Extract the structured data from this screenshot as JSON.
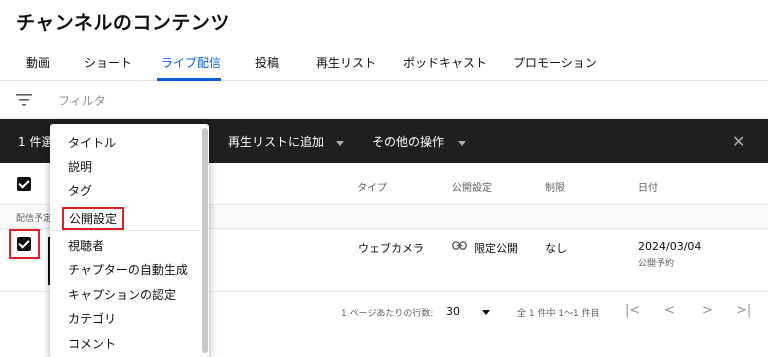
{
  "page": {
    "title": "チャンネルのコンテンツ"
  },
  "tabs": [
    {
      "label": "動画"
    },
    {
      "label": "ショート"
    },
    {
      "label": "ライブ配信"
    },
    {
      "label": "投稿"
    },
    {
      "label": "再生リスト"
    },
    {
      "label": "ポッドキャスト"
    },
    {
      "label": "プロモーション"
    }
  ],
  "active_tab": "ライブ配信",
  "filter": {
    "placeholder": "フィルタ",
    "icon": "filter-icon"
  },
  "actionbar": {
    "selected_count": "1 件選",
    "add_to_playlist": "再生リストに追加",
    "more_actions": "その他の操作",
    "close_icon": "close-icon"
  },
  "table": {
    "headers": {
      "type": "タイプ",
      "visibility": "公開設定",
      "restrictions": "制限",
      "date": "日付"
    },
    "section_label": "配信予定",
    "row": {
      "type": "ウェブカメラ",
      "visibility": "限定公開",
      "restrictions": "なし",
      "date": "2024/03/04",
      "date_sub": "公開予約"
    }
  },
  "pagination": {
    "rows_per_page_label": "1 ページあたりの行数:",
    "rows_per_page": "30",
    "range": "全 1 件中 1〜1 件目",
    "first": "|<",
    "prev": "<",
    "next": ">",
    "last": ">|"
  },
  "dropdown": {
    "items": [
      "タイトル",
      "説明",
      "タグ",
      "公開設定",
      "視聴者",
      "チャプターの自動生成",
      "キャプションの認定",
      "カテゴリ",
      "コメント"
    ],
    "highlighted": "公開設定"
  },
  "colors": {
    "accent": "#065fd4",
    "highlight_box": "#e02020",
    "actionbar_bg": "#1f1f1f"
  }
}
